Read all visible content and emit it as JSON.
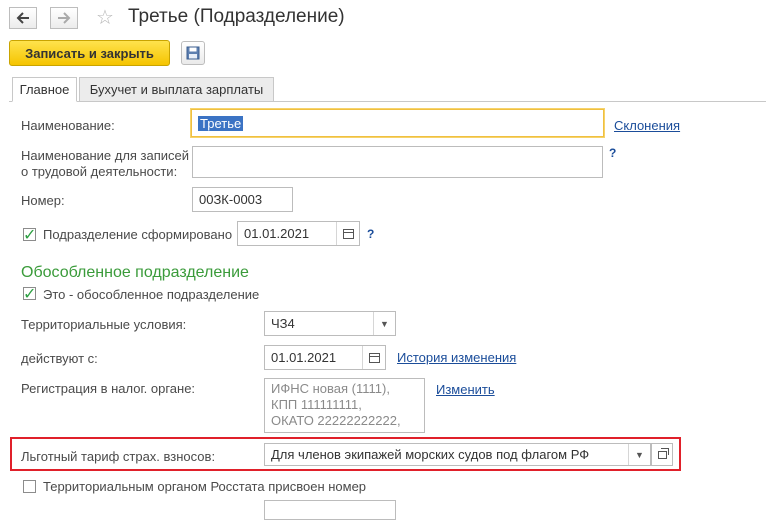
{
  "window": {
    "title": "Третье (Подразделение)",
    "back_icon": "arrow-left-icon",
    "forward_icon": "arrow-right-icon",
    "favorite_icon": "star-icon"
  },
  "toolbar": {
    "save_close_label": "Записать и закрыть",
    "save_icon": "floppy-disk-icon"
  },
  "tabs": [
    {
      "label": "Главное",
      "active": true
    },
    {
      "label": "Бухучет и выплата зарплаты",
      "active": false
    }
  ],
  "form": {
    "name_label": "Наименование:",
    "name_value": "Третье",
    "declensions_link": "Склонения",
    "labor_name_label_line1": "Наименование для записей",
    "labor_name_label_line2": "о трудовой деятельности:",
    "labor_name_value": "",
    "help_mark": "?",
    "number_label": "Номер:",
    "number_value": "00ЗК-0003",
    "formed_label": "Подразделение сформировано",
    "formed_checked": true,
    "formed_date": "01.01.2021",
    "section_title": "Обособленное подразделение",
    "separate_label": "Это - обособленное подразделение",
    "separate_checked": true,
    "territorial_label": "Территориальные условия:",
    "territorial_value": "ЧЗ4",
    "valid_from_label": "действуют с:",
    "valid_from_value": "01.01.2021",
    "history_link": "История изменения",
    "tax_reg_label": "Регистрация в налог. органе:",
    "tax_reg_lines": [
      "ИФНС новая (1111),",
      "КПП 111111111,",
      "ОКАТО 22222222222,"
    ],
    "change_link": "Изменить",
    "tariff_label": "Льготный тариф страх. взносов:",
    "tariff_value": "Для членов экипажей морских судов под флагом РФ",
    "rosstat_label": "Территориальным органом Росстата присвоен номер",
    "rosstat_checked": false
  },
  "colors": {
    "accent_yellow": "#f5c400",
    "section_green": "#3a9b3a",
    "link_blue": "#1b4d9a",
    "highlight_red": "#e0202a",
    "focus_border": "#f0c040"
  }
}
